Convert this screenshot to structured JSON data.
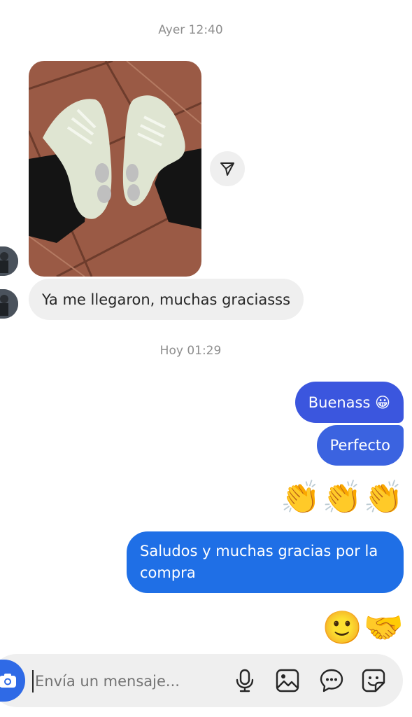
{
  "timestamps": {
    "yesterday": "Ayer 12:40",
    "today": "Hoy 01:29"
  },
  "incoming": {
    "photo": "sneakers-photo",
    "text": "Ya me llegaron, muchas graciasss"
  },
  "outgoing": {
    "msg1": "Buenass 😀",
    "msg2": "Perfecto",
    "reactions1": [
      "👏",
      "👏",
      "👏"
    ],
    "msg3_line1": "Saludos y muchas gracias por la",
    "msg3_line2": "compra",
    "reactions2": [
      "🙂",
      "🤝"
    ]
  },
  "composer": {
    "placeholder": "Envía un mensaje..."
  },
  "icons": {
    "share": "send-icon",
    "camera": "camera-icon",
    "mic": "microphone-icon",
    "gallery": "gallery-icon",
    "chat": "chat-bubble-icon",
    "sticker": "sticker-icon"
  },
  "colors": {
    "incoming_bubble": "#efefef",
    "outgoing_bubble_1": "#3b56de",
    "outgoing_bubble_2": "#3b63e0",
    "outgoing_bubble_3": "#1f6fe6",
    "camera_button": "#2f6ae6",
    "timestamp_text": "#8e8e8e"
  }
}
